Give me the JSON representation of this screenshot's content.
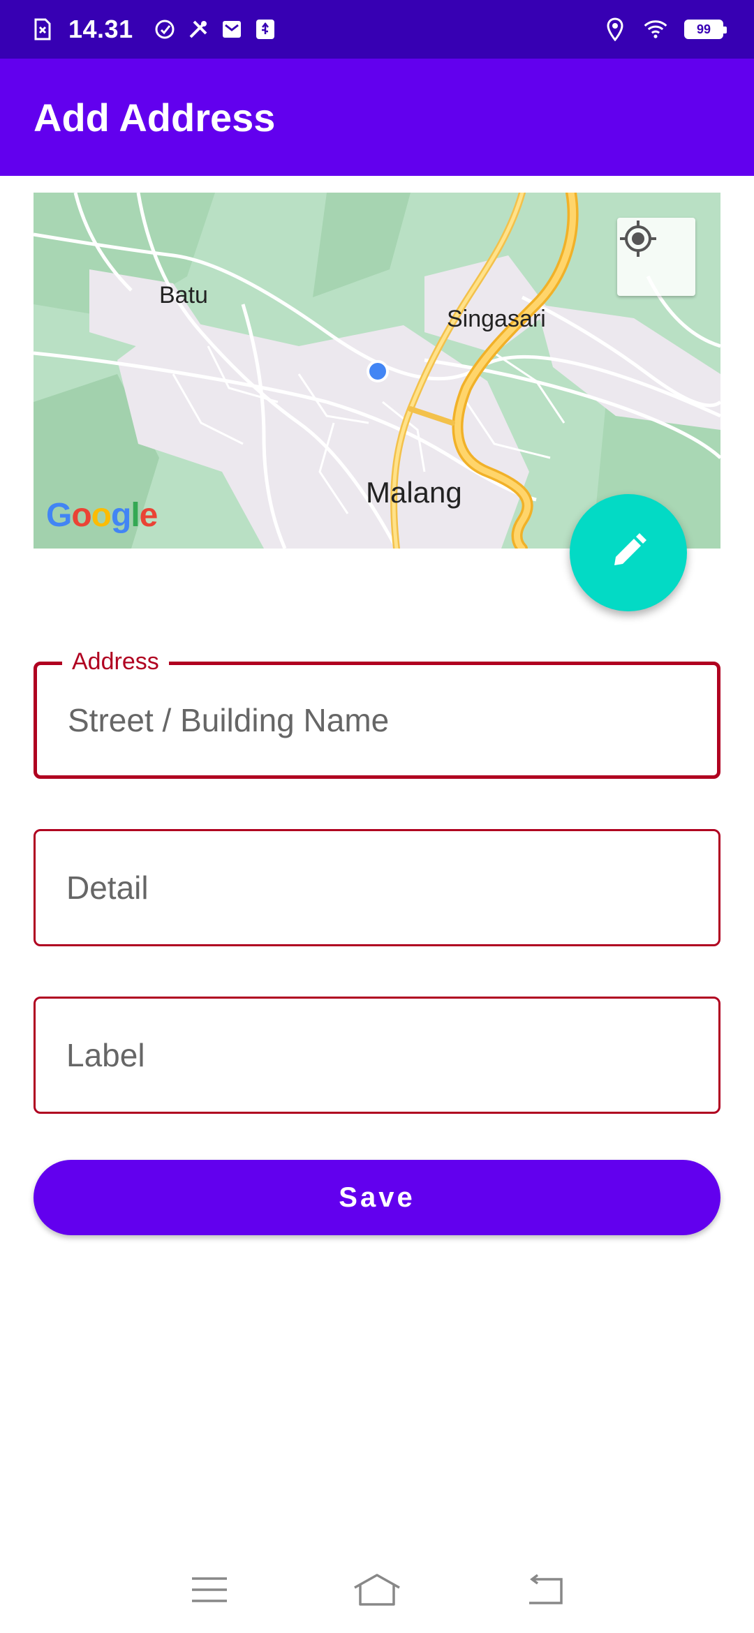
{
  "status_bar": {
    "time": "14.31",
    "battery": "99"
  },
  "app_bar": {
    "title": "Add Address"
  },
  "map": {
    "labels": {
      "batu": "Batu",
      "singasari": "Singasari",
      "malang": "Malang"
    },
    "logo_letters": [
      "G",
      "o",
      "o",
      "g",
      "l",
      "e"
    ]
  },
  "form": {
    "address": {
      "label": "Address",
      "placeholder": "Street / Building Name",
      "value": ""
    },
    "detail": {
      "placeholder": "Detail",
      "value": ""
    },
    "label": {
      "placeholder": "Label",
      "value": ""
    },
    "save_label": "Save"
  },
  "colors": {
    "status_bar": "#3700b3",
    "primary": "#6200ee",
    "accent": "#03dac5",
    "error": "#b00020"
  },
  "icons": {
    "my_location": "crosshair-icon",
    "edit": "pencil-icon"
  }
}
